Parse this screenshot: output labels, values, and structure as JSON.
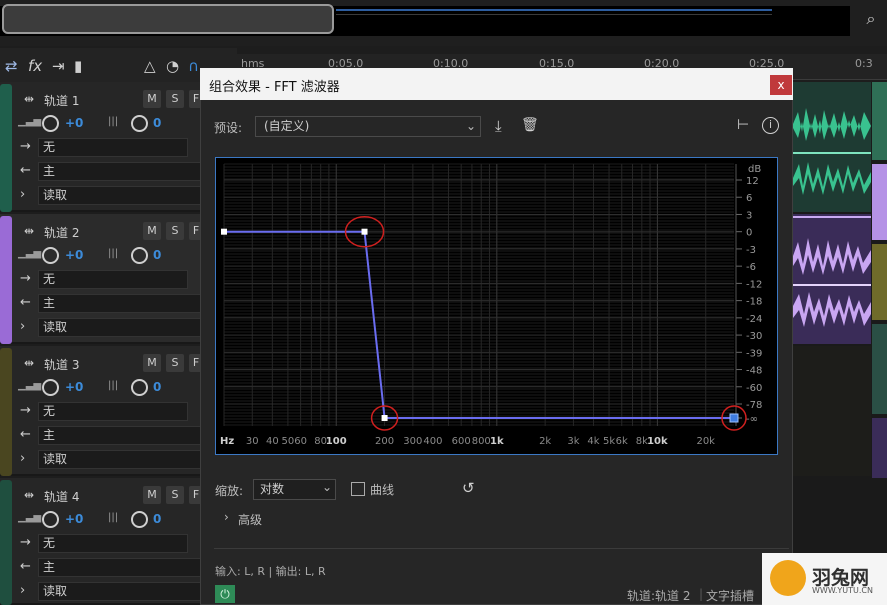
{
  "overview": {
    "zoom_icon": "zoom-icon"
  },
  "toolbar": {
    "icons": [
      "swap-icon",
      "fx-icon",
      "routing-icon",
      "meter-icon",
      "metronome-icon",
      "timer-icon",
      "snap-icon",
      "marker-icon"
    ],
    "fx_label": "fx"
  },
  "ruler": {
    "unit": "hms",
    "labels": [
      "0:05.0",
      "0:10.0",
      "0:15.0",
      "0:20.0",
      "0:25.0",
      "0:3"
    ]
  },
  "tracks": [
    {
      "name": "轨道 1",
      "vol": "+0",
      "pan": "0",
      "input": "无",
      "output": "主",
      "mode": "读取",
      "mute": "M",
      "solo": "S",
      "fx": "F",
      "color": "#2fa37a"
    },
    {
      "name": "轨道 2",
      "vol": "+0",
      "pan": "0",
      "input": "无",
      "output": "主",
      "mode": "读取",
      "mute": "M",
      "solo": "S",
      "fx": "F",
      "color": "#9a6bd6"
    },
    {
      "name": "轨道 3",
      "vol": "+0",
      "pan": "0",
      "input": "无",
      "output": "主",
      "mode": "读取",
      "mute": "M",
      "solo": "S",
      "fx": "F",
      "color": "#8a8328"
    },
    {
      "name": "轨道 4",
      "vol": "+0",
      "pan": "0",
      "input": "无",
      "output": "主",
      "mode": "读取",
      "mute": "M",
      "solo": "S",
      "fx": "F",
      "color": "#2f8a66"
    }
  ],
  "dialog": {
    "title": "组合效果 - FFT 滤波器",
    "close_label": "x",
    "preset_label": "预设:",
    "preset_value": "(自定义)",
    "scale_label": "缩放:",
    "scale_value": "对数",
    "curve_label": "曲线",
    "advanced_label": "高级",
    "io_label": "输入: L, R | 输出: L, R",
    "track_path": "轨道:轨道 2",
    "slot_label": "文字插槽"
  },
  "graph": {
    "db_unit": "dB",
    "db_labels": [
      "12",
      "6",
      "3",
      "0",
      "-3",
      "-6",
      "-12",
      "-18",
      "-24",
      "-30",
      "-39",
      "-48",
      "-60",
      "-78",
      "-∞"
    ],
    "freq_labels": [
      "Hz",
      "30",
      "40",
      "50",
      "60",
      "80",
      "100",
      "200",
      "300",
      "400",
      "600",
      "800",
      "1k",
      "2k",
      "3k",
      "4k",
      "5k",
      "6k",
      "8k",
      "10k",
      "20k"
    ],
    "points": [
      {
        "freq_hz": 20,
        "db": 0
      },
      {
        "freq_hz": 150,
        "db": 0
      },
      {
        "freq_hz": 200,
        "db": "-∞"
      },
      {
        "freq_hz": 30000,
        "db": "-∞"
      }
    ]
  },
  "logo": {
    "name": "羽兔网",
    "url": "WWW.YUTU.CN"
  }
}
